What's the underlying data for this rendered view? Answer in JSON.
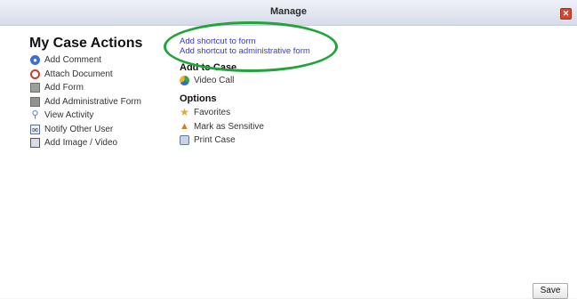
{
  "dialog": {
    "title": "Manage",
    "close_icon": "close-icon"
  },
  "case_actions": {
    "heading": "My Case Actions",
    "items": [
      {
        "label": "Add Comment",
        "icon": "comment-icon"
      },
      {
        "label": "Attach Document",
        "icon": "attach-icon"
      },
      {
        "label": "Add Form",
        "icon": "form-icon"
      },
      {
        "label": "Add Administrative Form",
        "icon": "admin-form-icon"
      },
      {
        "label": "View Activity",
        "icon": "magnifier-icon"
      },
      {
        "label": "Notify Other User",
        "icon": "envelope-icon"
      },
      {
        "label": "Add Image / Video",
        "icon": "image-icon"
      }
    ]
  },
  "shortcuts": {
    "add_form": "Add shortcut to form",
    "add_admin_form": "Add shortcut to administrative form"
  },
  "add_to_case": {
    "heading": "Add to Case",
    "items": [
      {
        "label": "Video Call",
        "icon": "video-call-icon"
      }
    ]
  },
  "options": {
    "heading": "Options",
    "items": [
      {
        "label": "Favorites",
        "icon": "star-icon"
      },
      {
        "label": "Mark as Sensitive",
        "icon": "warning-icon"
      },
      {
        "label": "Print Case",
        "icon": "printer-icon"
      }
    ]
  },
  "footer": {
    "save_label": "Save"
  },
  "colors": {
    "link": "#3a3ad2",
    "highlight": "#22a43a",
    "close": "#d8442e"
  }
}
